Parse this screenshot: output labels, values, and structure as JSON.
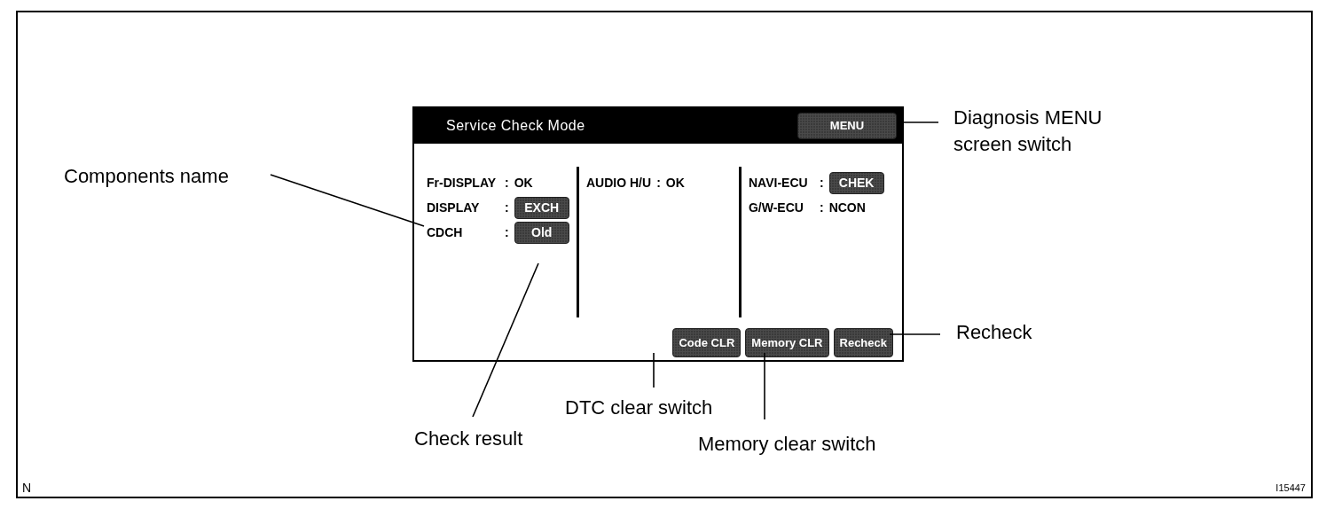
{
  "screen": {
    "title": "Service Check Mode",
    "menu_button": "MENU",
    "columns": [
      {
        "items": [
          {
            "label": "Fr-DISPLAY",
            "separator": ":",
            "value": "OK",
            "kind": "text"
          },
          {
            "label": "DISPLAY",
            "separator": ":",
            "value": "EXCH",
            "kind": "badge"
          },
          {
            "label": "CDCH",
            "separator": ":",
            "value": "Old",
            "kind": "badge"
          }
        ]
      },
      {
        "items": [
          {
            "label": "AUDIO H/U",
            "separator": ":",
            "value": "OK",
            "kind": "text"
          }
        ]
      },
      {
        "items": [
          {
            "label": "NAVI-ECU",
            "separator": ":",
            "value": "CHEK",
            "kind": "badge"
          },
          {
            "label": "G/W-ECU",
            "separator": ":",
            "value": "NCON",
            "kind": "text"
          }
        ]
      }
    ],
    "buttons": [
      "Code CLR",
      "Memory CLR",
      "Recheck"
    ]
  },
  "callouts": [
    {
      "text": "Components name",
      "kind": "components"
    },
    {
      "text": "Diagnosis MENU\nscreen switch",
      "kind": "menu"
    },
    {
      "text": "Recheck",
      "kind": "recheck"
    },
    {
      "text": "DTC clear switch",
      "kind": "dtc"
    },
    {
      "text": "Check result",
      "kind": "result"
    },
    {
      "text": "Memory clear switch",
      "kind": "memory"
    }
  ],
  "corner_mark": "N",
  "figure_number": "I15447"
}
